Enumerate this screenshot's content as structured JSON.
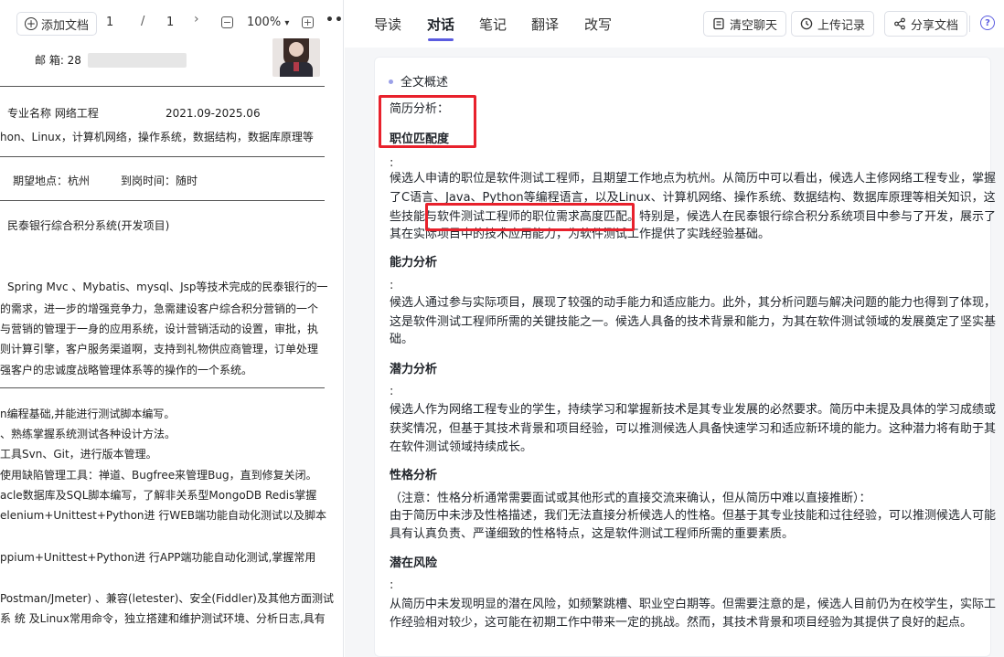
{
  "left_toolbar": {
    "add_doc_label": "添加文档",
    "page_current": "1",
    "page_separator": "/",
    "page_total": "1",
    "next_glyph": "›",
    "zoom_out_glyph": "−",
    "zoom_level": "100%",
    "zoom_caret": "▾",
    "zoom_in_glyph": "+",
    "more_glyph": "•••"
  },
  "document": {
    "email_label": "邮 箱: 28",
    "edu_line": "专业名称 网络工程",
    "edu_dates": "2021.09-2025.06",
    "skills_summary": "hon、Linux，计算机网络，操作系统，数据结构，数据库原理等",
    "location": "期望地点：杭州",
    "start_time": "到岗时间：随时",
    "project_title": "民泰银行综合积分系统(开发项目)",
    "project_desc": [
      "Spring Mvc 、Mybatis、mysql、Jsp等技术完成的民泰银行的一",
      "的需求，进一步的增强竞争力，急需建设客户综合积分营销的一个",
      "与营销的管理于一身的应用系统，设计营销活动的设置，审批，执",
      "则计算引擎，客户服务渠道啊，支持到礼物供应商管理，订单处理",
      "强客户的忠诚度战略管理体系等的操作的一个系统。"
    ],
    "skills_list": [
      "n编程基础,并能进行测试脚本编写。",
      "、熟练掌握系统测试各种设计方法。",
      "工具Svn、Git，进行版本管理。",
      "使用缺陷管理工具：禅道、Bugfree来管理Bug，直到修复关闭。",
      "acle数据库及SQL脚本编写，了解非关系型MongoDB Redis掌握",
      "elenium+Unittest+Python进 行WEB端功能自动化测试以及脚本",
      "",
      "ppium+Unittest+Python进 行APP端功能自动化测试,掌握常用",
      "",
      "Postman/Jmeter) 、兼容(letester)、安全(Fiddler)及其他方面测试",
      "系 统 及Linux常用命令，独立搭建和维护测试环境、分析日志,具有"
    ]
  },
  "right_toolbar": {
    "tabs": [
      "导读",
      "对话",
      "笔记",
      "翻译",
      "改写"
    ],
    "active_tab": "对话",
    "clear_chat": "清空聊天",
    "upload_history": "上传记录",
    "share_doc": "分享文档",
    "help_glyph": "?"
  },
  "chat": {
    "overview": "全文概述",
    "resume_analysis": "简历分析：",
    "sections": [
      {
        "heading": "职位匹配度",
        "colon": ":",
        "lines": [
          "候选人申请的职位是软件测试工程师，且期望工作地点为杭州。从简历中可以看出，候选人主修网络工程专业，掌握",
          "了C语言、Java、Python等编程语言，以及Linux、计算机网络、操作系统、数据结构、数据库原理等相关知识，这",
          "些技能与软件测试工程师的职位需求高度匹配。特别是，候选人在民泰银行综合积分系统项目中参与了开发，展示了",
          "其在实际项目中的技术应用能力，为软件测试工作提供了实践经验基础。"
        ]
      },
      {
        "heading": "能力分析",
        "colon": ":",
        "lines": [
          "候选人通过参与实际项目，展现了较强的动手能力和适应能力。此外，其分析问题与解决问题的能力也得到了体现，",
          "这是软件测试工程师所需的关键技能之一。候选人具备的技术背景和能力，为其在软件测试领域的发展奠定了坚实基",
          "础。"
        ]
      },
      {
        "heading": "潜力分析",
        "colon": ":",
        "lines": [
          "候选人作为网络工程专业的学生，持续学习和掌握新技术是其专业发展的必然要求。简历中未提及具体的学习成绩或",
          "获奖情况，但基于其技术背景和项目经验，可以推测候选人具备快速学习和适应新环境的能力。这种潜力将有助于其",
          "在软件测试领域持续成长。"
        ]
      },
      {
        "heading": "性格分析",
        "colon": "",
        "lines": [
          "（注意：性格分析通常需要面试或其他形式的直接交流来确认，但从简历中难以直接推断）：",
          "由于简历中未涉及性格描述，我们无法直接分析候选人的性格。但基于其专业技能和过往经验，可以推测候选人可能",
          "具有认真负责、严谨细致的性格特点，这是软件测试工程师所需的重要素质。"
        ]
      },
      {
        "heading": "潜在风险",
        "colon": ":",
        "lines": [
          "从简历中未发现明显的潜在风险，如频繁跳槽、职业空白期等。但需要注意的是，候选人目前仍为在校学生，实际工",
          "作经验相对较少，这可能在初期工作中带来一定的挑战。然而，其技术背景和项目经验为其提供了良好的起点。"
        ]
      }
    ]
  },
  "colors": {
    "accent": "#5b5ce0",
    "highlight_box": "#e8212c"
  }
}
